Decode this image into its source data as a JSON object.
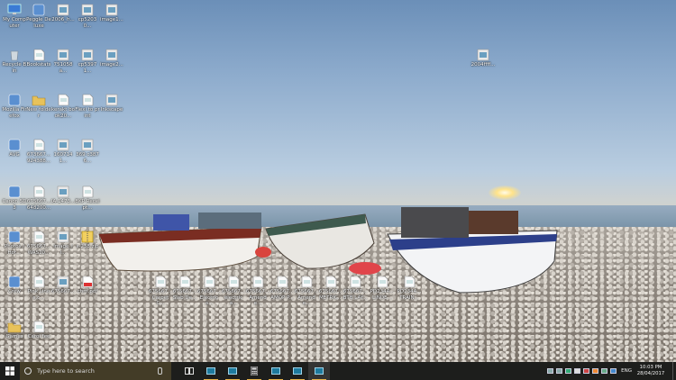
{
  "desktop": {
    "icons": [
      {
        "label": "My Computer",
        "glyph": "pc"
      },
      {
        "label": "Peggle Deluxe",
        "glyph": "app"
      },
      {
        "label": "2006_h...",
        "glyph": "img"
      },
      {
        "label": "cp52030...",
        "glyph": "img"
      },
      {
        "label": "image1...",
        "glyph": "img"
      },
      {
        "label": "Recycle Bin",
        "glyph": "bin"
      },
      {
        "label": "Bookstats",
        "glyph": "doc"
      },
      {
        "label": "751058a...",
        "glyph": "img"
      },
      {
        "label": "cp53971...",
        "glyph": "img"
      },
      {
        "label": "image2...",
        "glyph": "img"
      },
      {
        "label": "2004ffff...",
        "glyph": "img"
      },
      {
        "label": "Mozilla Firefox",
        "glyph": "app"
      },
      {
        "label": "New folder",
        "glyph": "folder"
      },
      {
        "label": "kerakt book20...",
        "glyph": "doc"
      },
      {
        "label": "Flexi to print",
        "glyph": "doc"
      },
      {
        "label": "Inkscape",
        "glyph": "img"
      },
      {
        "label": "AVG",
        "glyph": "app"
      },
      {
        "label": "673667... 924388...",
        "glyph": "doc"
      },
      {
        "label": "1607141...",
        "glyph": "img"
      },
      {
        "label": "369 c3876...",
        "glyph": "img"
      },
      {
        "label": "Canon 5D3",
        "glyph": "app"
      },
      {
        "label": "675667... 648200...",
        "glyph": "doc"
      },
      {
        "label": "IA-1473...",
        "glyph": "img"
      },
      {
        "label": "BKP Receipt...",
        "glyph": "doc"
      },
      {
        "label": "Photos / Hot...",
        "glyph": "app"
      },
      {
        "label": "675667... WAS20...",
        "glyph": "doc"
      },
      {
        "label": "image_li...",
        "glyph": "img"
      },
      {
        "label": "s-238.zip",
        "glyph": "zip"
      },
      {
        "label": "Crew",
        "glyph": "app"
      },
      {
        "label": "Pink Lines.c...",
        "glyph": "doc"
      },
      {
        "label": "675667...",
        "glyph": "img"
      },
      {
        "label": "chm.pdf",
        "glyph": "pdf"
      },
      {
        "label": "675667... Carpet C...",
        "glyph": "doc"
      },
      {
        "label": "675667... Slab De...",
        "glyph": "doc"
      },
      {
        "label": "675667... Electrica...",
        "glyph": "doc"
      },
      {
        "label": "675667... electrica...",
        "glyph": "doc"
      },
      {
        "label": "675667... Amende...",
        "glyph": "doc"
      },
      {
        "label": "675667... AMOP P...",
        "glyph": "doc"
      },
      {
        "label": "675667... Amende...",
        "glyph": "doc"
      },
      {
        "label": "675667... METRIC...",
        "glyph": "doc"
      },
      {
        "label": "675667... BTB LAY...",
        "glyph": "doc"
      },
      {
        "label": "PD2344... LINDE...",
        "glyph": "doc"
      },
      {
        "label": "PD2344... TRAIN...",
        "glyph": "doc"
      },
      {
        "label": "Games",
        "glyph": "folder"
      },
      {
        "label": "Carol fee",
        "glyph": "doc"
      }
    ]
  },
  "taskbar": {
    "start_icon": "windows-logo-icon",
    "search_placeholder": "Type here to search",
    "apps": [
      {
        "name": "task-view",
        "state": "idle"
      },
      {
        "name": "window-1",
        "state": "running"
      },
      {
        "name": "window-2",
        "state": "running"
      },
      {
        "name": "calculator",
        "state": "running"
      },
      {
        "name": "window-3",
        "state": "running"
      },
      {
        "name": "window-4",
        "state": "running"
      },
      {
        "name": "window-5",
        "state": "active"
      }
    ],
    "tray": {
      "language": "ENG",
      "time": "10:03 PM",
      "date": "28/04/2017"
    },
    "accent_color": "#e8b54a"
  }
}
